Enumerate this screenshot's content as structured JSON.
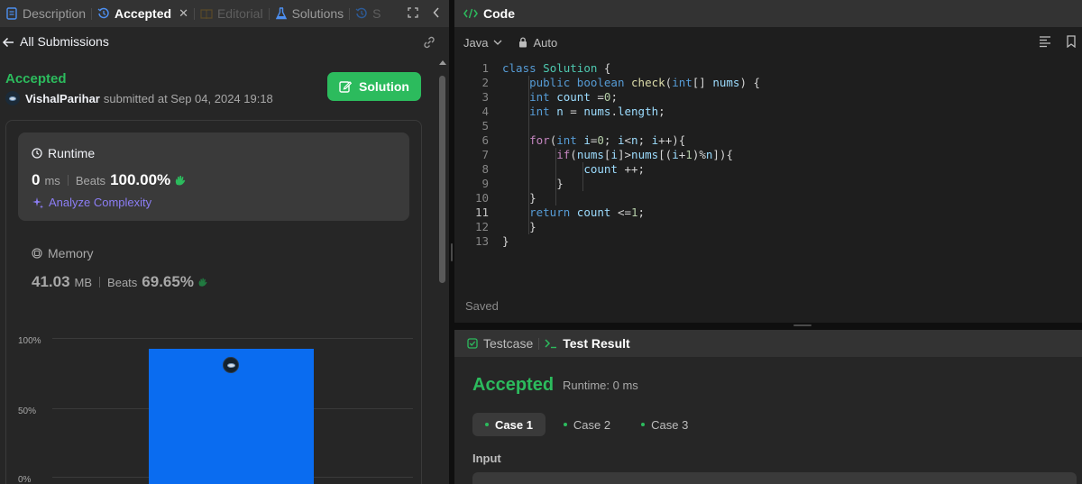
{
  "left_tabs": [
    {
      "label": "Description",
      "icon": "description-icon",
      "state": "normal"
    },
    {
      "label": "Accepted",
      "icon": "history-icon",
      "state": "active"
    },
    {
      "label": "Editorial",
      "icon": "book-icon",
      "state": "dim"
    },
    {
      "label": "Solutions",
      "icon": "flask-icon",
      "state": "normal"
    },
    {
      "label": "S",
      "icon": "history-icon",
      "state": "dim"
    }
  ],
  "nav": {
    "back_label": "All Submissions"
  },
  "submission": {
    "status": "Accepted",
    "user": "VishalParihar",
    "submitted_text": "submitted at Sep 04, 2024 19:18",
    "solution_button": "Solution"
  },
  "runtime": {
    "label": "Runtime",
    "value": "0",
    "unit": "ms",
    "beats_label": "Beats",
    "beats_value": "100.00%",
    "analyze": "Analyze Complexity"
  },
  "memory": {
    "label": "Memory",
    "value": "41.03",
    "unit": "MB",
    "beats_label": "Beats",
    "beats_value": "69.65%"
  },
  "chart_data": {
    "type": "bar",
    "yticks": [
      "100%",
      "50%",
      "0%"
    ],
    "ylim": [
      0,
      100
    ],
    "values": [
      92
    ],
    "color": "#0a6cf0"
  },
  "code_panel": {
    "title": "Code",
    "language": "Java",
    "mode": "Auto",
    "saved_label": "Saved",
    "lines": [
      "class Solution {",
      "    public boolean check(int[] nums) {",
      "    int count =0;",
      "    int n = nums.length;",
      "",
      "    for(int i=0; i<n; i++){",
      "        if(nums[i]>nums[(i+1)%n]){",
      "            count ++;",
      "        }",
      "    }",
      "    return count <=1;",
      "    }",
      "}"
    ]
  },
  "test_panel": {
    "tab_testcase": "Testcase",
    "tab_result": "Test Result",
    "status": "Accepted",
    "runtime": "Runtime: 0 ms",
    "cases": [
      "Case 1",
      "Case 2",
      "Case 3"
    ],
    "input_label": "Input"
  },
  "colors": {
    "accent_green": "#2cbb5d",
    "bar_blue": "#0a6cf0",
    "analyze_purple": "#8c7ef5"
  }
}
